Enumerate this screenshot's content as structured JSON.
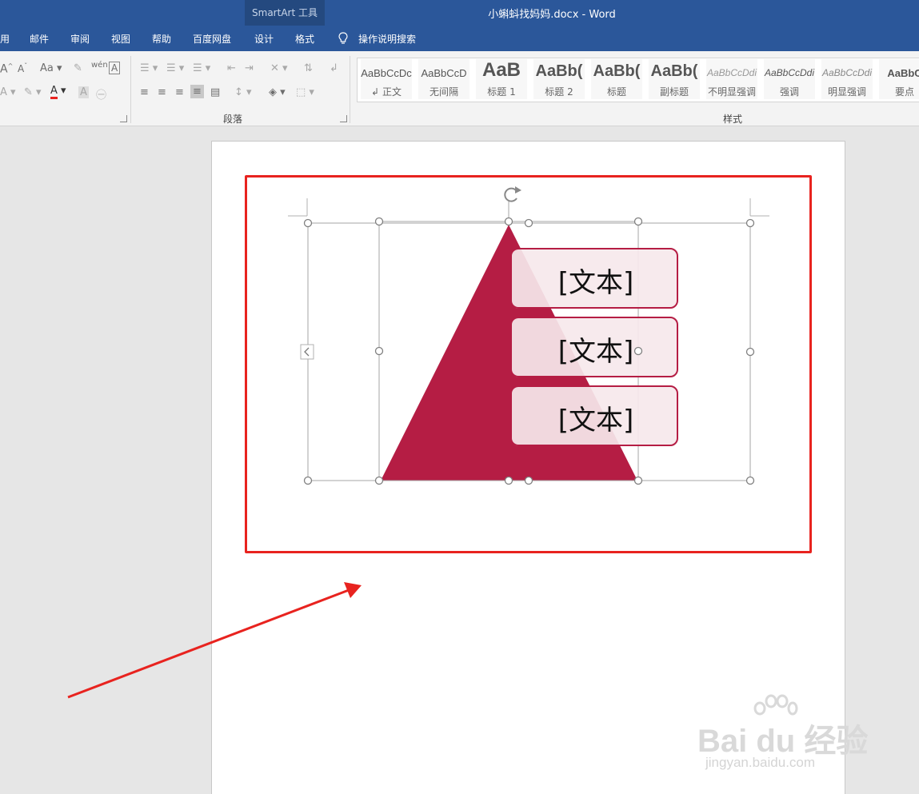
{
  "titlebar": {
    "context_group": "SmartArt 工具",
    "document_title": "小蝌蚪找妈妈.docx  -  Word",
    "background": "#2b579a"
  },
  "tabs": {
    "partial_left": "用",
    "mail": "邮件",
    "review": "审阅",
    "view": "视图",
    "help": "帮助",
    "baidu_netdisk": "百度网盘",
    "design": "设计",
    "format": "格式",
    "tell_me": "操作说明搜索"
  },
  "ribbon": {
    "paragraph_group": "段落",
    "styles_group": "样式",
    "font_size_label": "Aa",
    "font_color_label": "A",
    "styles": [
      {
        "preview": "AaBbCcDc",
        "name": "正文",
        "prefix": "↲"
      },
      {
        "preview": "AaBbCcD",
        "name": "无间隔"
      },
      {
        "preview": "AaB",
        "name": "标题 1"
      },
      {
        "preview": "AaBb(",
        "name": "标题 2"
      },
      {
        "preview": "AaBb(",
        "name": "标题"
      },
      {
        "preview": "AaBb(",
        "name": "副标题"
      },
      {
        "preview": "AaBbCcDdi",
        "name": "不明显强调"
      },
      {
        "preview": "AaBbCcDdi",
        "name": "强调"
      },
      {
        "preview": "AaBbCcDdi",
        "name": "明显强调"
      },
      {
        "preview": "AaBbC",
        "name": "要点"
      }
    ]
  },
  "smartart": {
    "items": [
      "[文本]",
      "[文本]",
      "[文本]"
    ],
    "shape_color": "#b51d44",
    "box_fill": "#f6e8eb"
  },
  "annotation": {
    "box_color": "#e8231f",
    "arrow_color": "#e8231f"
  },
  "watermark": {
    "brand": "Bai du 经验",
    "url": "jingyan.baidu.com"
  }
}
